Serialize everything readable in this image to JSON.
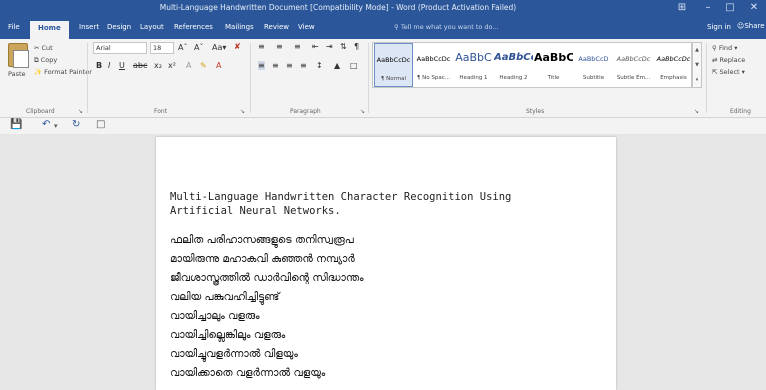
{
  "window": {
    "title": "Multi-Language Handwritten Document [Compatibility Mode] - Word (Product Activation Failed)",
    "controls": [
      "⊞",
      "–",
      "□",
      "✕"
    ]
  },
  "tabs": [
    "File",
    "Home",
    "Insert",
    "Design",
    "Layout",
    "References",
    "Mailings",
    "Review",
    "View"
  ],
  "tell_me": "Tell me what you want to do...",
  "account": {
    "sign_in": "Sign in",
    "share": "Share"
  },
  "clipboard": {
    "paste": "Paste",
    "cut": "Cut",
    "copy": "Copy",
    "format_painter": "Format Painter",
    "label": "Clipboard"
  },
  "font": {
    "name": "Arial",
    "size": "18",
    "label": "Font"
  },
  "paragraph": {
    "label": "Paragraph"
  },
  "styles": {
    "label": "Styles",
    "items": [
      {
        "sample": "AaBbCcDc",
        "name": "¶ Normal"
      },
      {
        "sample": "AaBbCcDc",
        "name": "¶ No Spac..."
      },
      {
        "sample": "AaBbC",
        "name": "Heading 1"
      },
      {
        "sample": "AaBbCc",
        "name": "Heading 2"
      },
      {
        "sample": "AaBbC",
        "name": "Title"
      },
      {
        "sample": "AaBbCcD",
        "name": "Subtitle"
      },
      {
        "sample": "AaBbCcDc",
        "name": "Subtle Em..."
      },
      {
        "sample": "AaBbCcDc",
        "name": "Emphasis"
      }
    ]
  },
  "editing": {
    "find": "Find",
    "replace": "Replace",
    "select": "Select",
    "label": "Editing"
  },
  "document": {
    "title": "Multi-Language Handwritten Character Recognition Using\nArtificial Neural Networks.",
    "lines": [
      "ഫലിത പരിഹാസങ്ങളുടെ തനിസ്വരൂപ",
      "മായിരുന്നു മഹാകവി കുഞ്ഞൻ നമ്പ്യാർ",
      "ജീവശാസ്ത്രത്തിൽ ഡാർവിന്റെ സിദ്ധാന്തം",
      "വലിയ പങ്കുവഹിച്ചിട്ടുണ്ട്",
      "വായിച്ചാലും വളരും",
      "വായിച്ചില്ലെങ്കിലും വളരും",
      "വായിച്ചുവളർന്നാൽ വിളയും",
      "വായിക്കാതെ വളർന്നാൽ വളയും"
    ]
  },
  "colors": {
    "accent": "#2b579a",
    "ribbon": "#f3f3f3",
    "canvas": "#e6e6e6"
  }
}
